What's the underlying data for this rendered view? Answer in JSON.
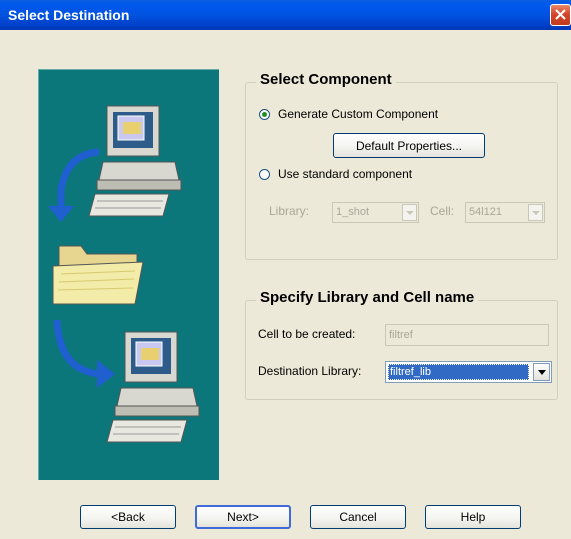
{
  "window": {
    "title": "Select Destination"
  },
  "select_component": {
    "title": "Select Component",
    "generate_custom": {
      "label": "Generate Custom Component",
      "selected": true
    },
    "default_properties_button": "Default Properties...",
    "use_standard": {
      "label": "Use standard component",
      "selected": false
    },
    "library": {
      "label": "Library:",
      "value": "1_shot"
    },
    "cell": {
      "label": "Cell:",
      "value": "54l121"
    }
  },
  "specify": {
    "title": "Specify Library and Cell name",
    "cell_to_create": {
      "label": "Cell  to be created:",
      "value": "filtref"
    },
    "destination_library": {
      "label": "Destination Library:",
      "value": "filtref_lib"
    }
  },
  "buttons": {
    "back": "<Back",
    "next": "Next>",
    "cancel": "Cancel",
    "help": "Help"
  },
  "colors": {
    "title_bar": "#0054e3",
    "art_panel": "#0b777a",
    "selection": "#316ac5"
  }
}
